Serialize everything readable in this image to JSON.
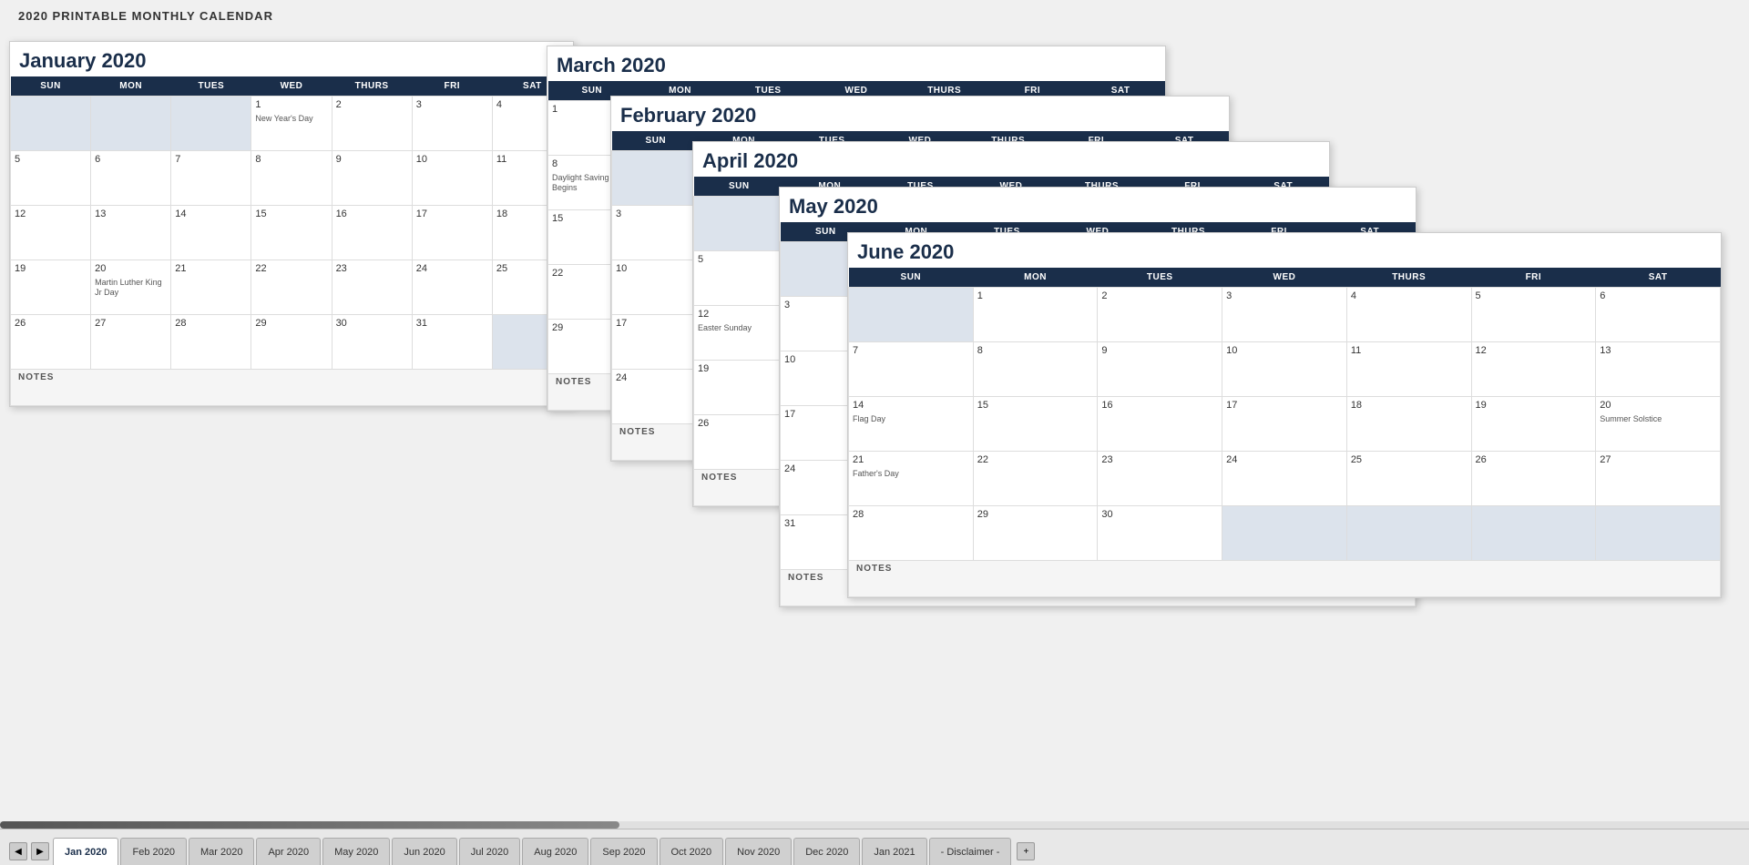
{
  "page": {
    "title": "2020 PRINTABLE MONTHLY CALENDAR"
  },
  "tabs": [
    {
      "label": "Jan 2020",
      "active": true
    },
    {
      "label": "Feb 2020",
      "active": false
    },
    {
      "label": "Mar 2020",
      "active": false
    },
    {
      "label": "Apr 2020",
      "active": false
    },
    {
      "label": "May 2020",
      "active": false
    },
    {
      "label": "Jun 2020",
      "active": false
    },
    {
      "label": "Jul 2020",
      "active": false
    },
    {
      "label": "Aug 2020",
      "active": false
    },
    {
      "label": "Sep 2020",
      "active": false
    },
    {
      "label": "Oct 2020",
      "active": false
    },
    {
      "label": "Nov 2020",
      "active": false
    },
    {
      "label": "Dec 2020",
      "active": false
    },
    {
      "label": "Jan 2021",
      "active": false
    },
    {
      "label": "- Disclaimer -",
      "active": false
    }
  ],
  "colors": {
    "header_bg": "#1a2e4a",
    "empty_cell": "#dce3ec",
    "notes_bg": "#f5f5f5"
  }
}
